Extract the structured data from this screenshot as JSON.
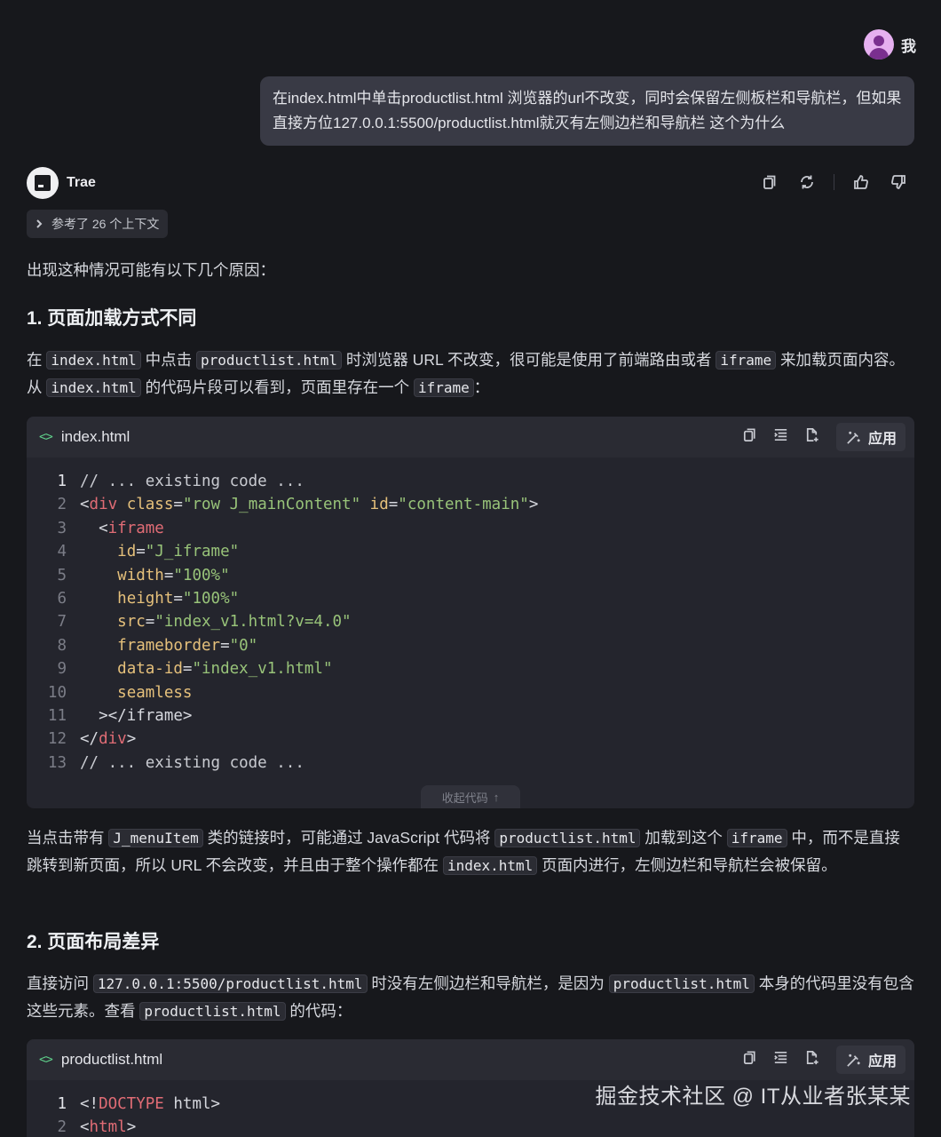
{
  "user": {
    "name": "我",
    "message": "在index.html中单击productlist.html 浏览器的url不改变，同时会保留左侧板栏和导航栏，但如果直接方位127.0.0.1:5500/productlist.html就灭有左侧边栏和导航栏 这个为什么"
  },
  "assistant": {
    "name": "Trae",
    "context_chip": "参考了 26 个上下文",
    "intro": "出现这种情况可能有以下几个原因："
  },
  "section1": {
    "title": "1. 页面加载方式不同",
    "para": {
      "t1": "在 ",
      "c1": "index.html",
      "t2": " 中点击 ",
      "c2": "productlist.html",
      "t3": " 时浏览器 URL 不改变，很可能是使用了前端路由或者 ",
      "c3": "iframe",
      "t4": " 来加载页面内容。从 ",
      "c4": "index.html",
      "t5": " 的代码片段可以看到，页面里存在一个 ",
      "c5": "iframe",
      "t6": "："
    },
    "code": {
      "filename": "index.html",
      "apply_label": "应用",
      "collapse_label": "收起代码",
      "lines": [
        {
          "n": "1",
          "code": "// ... existing code ..."
        },
        {
          "n": "2",
          "code": "<div class=\"row J_mainContent\" id=\"content-main\">"
        },
        {
          "n": "3",
          "code": "  <iframe"
        },
        {
          "n": "4",
          "code": "    id=\"J_iframe\""
        },
        {
          "n": "5",
          "code": "    width=\"100%\""
        },
        {
          "n": "6",
          "code": "    height=\"100%\""
        },
        {
          "n": "7",
          "code": "    src=\"index_v1.html?v=4.0\""
        },
        {
          "n": "8",
          "code": "    frameborder=\"0\""
        },
        {
          "n": "9",
          "code": "    data-id=\"index_v1.html\""
        },
        {
          "n": "10",
          "code": "    seamless"
        },
        {
          "n": "11",
          "code": "  ></iframe>"
        },
        {
          "n": "12",
          "code": "</div>"
        },
        {
          "n": "13",
          "code": "// ... existing code ..."
        }
      ]
    },
    "para2": {
      "t1": "当点击带有 ",
      "c1": "J_menuItem",
      "t2": " 类的链接时，可能通过 JavaScript 代码将 ",
      "c2": "productlist.html",
      "t3": " 加载到这个 ",
      "c3": "iframe",
      "t4": " 中，而不是直接跳转到新页面，所以 URL 不会改变，并且由于整个操作都在 ",
      "c4": "index.html",
      "t5": " 页面内进行，左侧边栏和导航栏会被保留。"
    }
  },
  "section2": {
    "title": "2. 页面布局差异",
    "para": {
      "t1": "直接访问 ",
      "c1": "127.0.0.1:5500/productlist.html",
      "t2": " 时没有左侧边栏和导航栏，是因为 ",
      "c2": "productlist.html",
      "t3": " 本身的代码里没有包含这些元素。查看 ",
      "c3": "productlist.html",
      "t4": " 的代码："
    },
    "code": {
      "filename": "productlist.html",
      "apply_label": "应用",
      "lines": [
        {
          "n": "1",
          "code": "<!DOCTYPE html>"
        },
        {
          "n": "2",
          "code": "<html>"
        }
      ]
    }
  },
  "watermark": "掘金技术社区 @ IT从业者张某某",
  "colors": {
    "background": "#17181c",
    "bubble": "#393a45",
    "code_bg": "#24252d",
    "tag": "#e06c75",
    "attr": "#e5c07b",
    "string": "#98c379",
    "lang_icon": "#5fcf8a"
  },
  "icons": [
    "copy-icon",
    "refresh-icon",
    "thumbs-up-icon",
    "thumbs-down-icon",
    "chevron-right-icon",
    "code-icon",
    "insert-icon",
    "new-file-icon",
    "apply-magic-icon",
    "arrow-up-icon"
  ]
}
